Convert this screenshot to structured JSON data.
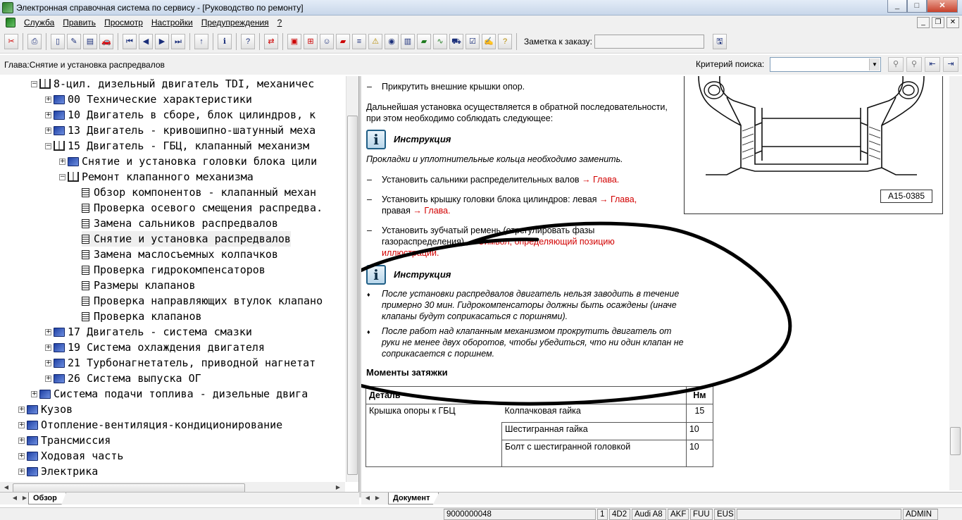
{
  "window": {
    "title": "Электронная справочная система по сервису - [Руководство по ремонту]"
  },
  "menu": [
    "Служба",
    "Править",
    "Просмотр",
    "Настройки",
    "Предупреждения",
    "?"
  ],
  "toolbar": {
    "note_label": "Заметка к заказу:",
    "note_value": ""
  },
  "chapter_bar": {
    "chapter": "Глава:Снятие и установка распредвалов",
    "search_label": "Критерий  поиска:",
    "search_value": ""
  },
  "tree": [
    {
      "label": "8-цил. дизельный двигатель TDI, механичес",
      "level": 1,
      "type": "bookopen",
      "exp": "-"
    },
    {
      "label": "00 Технические характеристики",
      "level": 2,
      "type": "book",
      "exp": "+"
    },
    {
      "label": "10 Двигатель в сборе, блок цилиндров, к",
      "level": 2,
      "type": "book",
      "exp": "+"
    },
    {
      "label": "13 Двигатель - кривошипно-шатунный меха",
      "level": 2,
      "type": "book",
      "exp": "+"
    },
    {
      "label": "15 Двигатель - ГБЦ, клапанный механизм",
      "level": 2,
      "type": "bookopen",
      "exp": "-"
    },
    {
      "label": "Снятие и установка головки блока цили",
      "level": 3,
      "type": "book",
      "exp": "+"
    },
    {
      "label": "Ремонт клапанного механизма",
      "level": 3,
      "type": "bookopen",
      "exp": "-"
    },
    {
      "label": "Обзор компонентов - клапанный механ",
      "level": 4,
      "type": "page",
      "exp": ""
    },
    {
      "label": "Проверка осевого смещения распредва.",
      "level": 4,
      "type": "page",
      "exp": ""
    },
    {
      "label": "Замена сальников распредвалов",
      "level": 4,
      "type": "page",
      "exp": ""
    },
    {
      "label": "Снятие и установка распредвалов",
      "level": 4,
      "type": "page",
      "exp": "",
      "selected": true
    },
    {
      "label": "Замена маслосъемных колпачков",
      "level": 4,
      "type": "page",
      "exp": ""
    },
    {
      "label": "Проверка гидрокомпенсаторов",
      "level": 4,
      "type": "page",
      "exp": ""
    },
    {
      "label": "Размеры клапанов",
      "level": 4,
      "type": "page",
      "exp": ""
    },
    {
      "label": "Проверка направляющих втулок клапано",
      "level": 4,
      "type": "page",
      "exp": ""
    },
    {
      "label": "Проверка клапанов",
      "level": 4,
      "type": "page",
      "exp": ""
    },
    {
      "label": "17 Двигатель - система смазки",
      "level": 2,
      "type": "book",
      "exp": "+"
    },
    {
      "label": "19 Система охлаждения двигателя",
      "level": 2,
      "type": "book",
      "exp": "+"
    },
    {
      "label": "21 Турбонагнетатель, приводной нагнетат",
      "level": 2,
      "type": "book",
      "exp": "+"
    },
    {
      "label": "26 Система выпуска ОГ",
      "level": 2,
      "type": "book",
      "exp": "+"
    },
    {
      "label": "Система подачи топлива - дизельные двига",
      "level": 1,
      "type": "book",
      "exp": "+"
    },
    {
      "label": "Кузов",
      "level": 0,
      "type": "book",
      "exp": "+"
    },
    {
      "label": "Отопление-вентиляция-кондиционирование",
      "level": 0,
      "type": "book",
      "exp": "+"
    },
    {
      "label": "Трансмиссия",
      "level": 0,
      "type": "book",
      "exp": "+"
    },
    {
      "label": "Ходовая часть",
      "level": 0,
      "type": "book",
      "exp": "+"
    },
    {
      "label": "Электрика",
      "level": 0,
      "type": "book",
      "exp": "+"
    }
  ],
  "doc": {
    "step1": "Прикрутить внешние крышки опор.",
    "para1": "Дальнейшая установка осуществляется в обратной последовательности, при этом необходимо соблюдать следующее:",
    "instr_title": "Инструкция",
    "instr1_text": "Прокладки и уплотнительные кольца необходимо заменить.",
    "step2": "Установить сальники распределительных валов",
    "step2_link": "→ Глава.",
    "step3a": "Установить крышку головки блока цилиндров: левая",
    "step3_link1": "→ Глава,",
    "step3b": "правая",
    "step3_link2": "→ Глава.",
    "step4": "Установить зубчатый ремень (отрегулировать фазы газораспределения)",
    "step4_link": "→ Символ, определяющий позицию иллюстрации.",
    "instr2_title": "Инструкция",
    "bullet1": "После установки распредвалов двигатель нельзя заводить в течение примерно 30 мин. Гидрокомпенсаторы должны быть осаждены (иначе клапаны будут соприкасаться с поршнями).",
    "bullet2": "После работ над клапанным механизмом прокрутить двигатель от руки не менее двух оборотов, чтобы убедиться, что ни один клапан не соприкасается с поршнем.",
    "moments_title": "Моменты затяжки",
    "table": {
      "header_part": "Деталь",
      "header_nm": "Нм",
      "group": "Крышка опоры к ГБЦ",
      "rows": [
        {
          "fastener": "Колпачковая гайка",
          "nm": "15"
        },
        {
          "fastener": "Шестигранная гайка",
          "nm": "10"
        },
        {
          "fastener": "Болт с шестигранной головкой",
          "nm": "10"
        }
      ]
    },
    "figure_label": "A15-0385"
  },
  "tabs": {
    "left": "Обзор",
    "right": "Документ"
  },
  "status": [
    "9000000048",
    "1",
    "4D2",
    "Audi A8",
    "AKF",
    "FUU",
    "EUS",
    "ADMIN"
  ]
}
